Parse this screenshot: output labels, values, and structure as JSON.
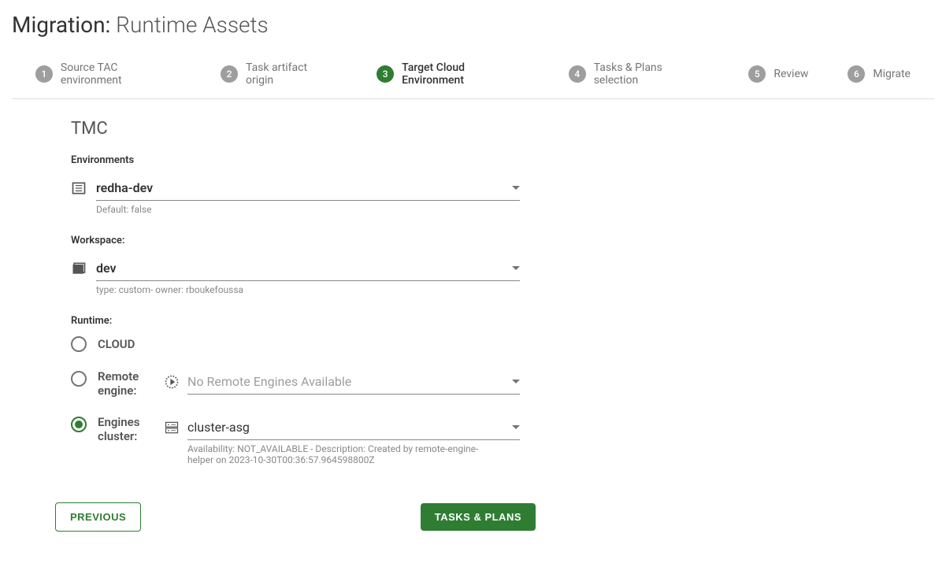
{
  "title_prefix": "Migration:",
  "title_main": "Runtime Assets",
  "steps": [
    {
      "num": "1",
      "label": "Source TAC environment"
    },
    {
      "num": "2",
      "label": "Task artifact origin"
    },
    {
      "num": "3",
      "label": "Target Cloud Environment"
    },
    {
      "num": "4",
      "label": "Tasks & Plans selection"
    },
    {
      "num": "5",
      "label": "Review"
    },
    {
      "num": "6",
      "label": "Migrate"
    }
  ],
  "active_step": 2,
  "section_title": "TMC",
  "environments": {
    "label": "Environments",
    "value": "redha-dev",
    "helper": "Default: false"
  },
  "workspace": {
    "label": "Workspace:",
    "value": "dev",
    "helper": "type: custom- owner: rboukefoussa"
  },
  "runtime": {
    "label": "Runtime:",
    "options": {
      "cloud": {
        "label": "CLOUD"
      },
      "remote": {
        "label": "Remote engine:",
        "placeholder": "No Remote Engines Available"
      },
      "cluster": {
        "label": "Engines cluster:",
        "value": "cluster-asg",
        "helper": "Availability: NOT_AVAILABLE - Description: Created by remote-engine-helper on 2023-10-30T00:36:57.964598800Z"
      }
    },
    "selected": "cluster"
  },
  "buttons": {
    "previous": "Previous",
    "next": "Tasks & Plans"
  }
}
